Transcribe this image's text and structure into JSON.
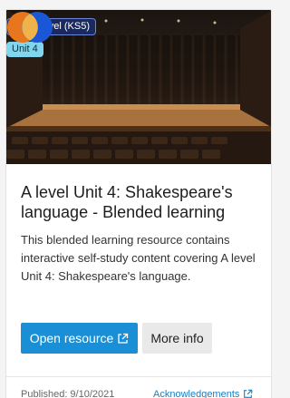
{
  "card": {
    "badges": {
      "level": "AS/A Level (KS5)",
      "unit": "Unit 4"
    },
    "image": {
      "subject": "theatre-stage-photo"
    },
    "brand_logo": {
      "colors": [
        "#e8761c",
        "#1a56d6"
      ]
    },
    "title": "A level Unit 4: Shakespeare's language - Blended learning",
    "description": "This blended learning resource contains interactive self-study content covering A level Unit 4: Shakespeare's language.",
    "actions": {
      "open_label": "Open resource",
      "open_icon": "external-link-icon",
      "more_label": "More info"
    },
    "footer": {
      "published": "Published: 9/10/2021",
      "acknowledgements": "Acknowledgements"
    }
  },
  "colors": {
    "primary": "#1a8fd6",
    "level_badge_bg": "#1b2a5e",
    "unit_badge_bg": "#7fd6ee",
    "link": "#1a7fc4"
  }
}
